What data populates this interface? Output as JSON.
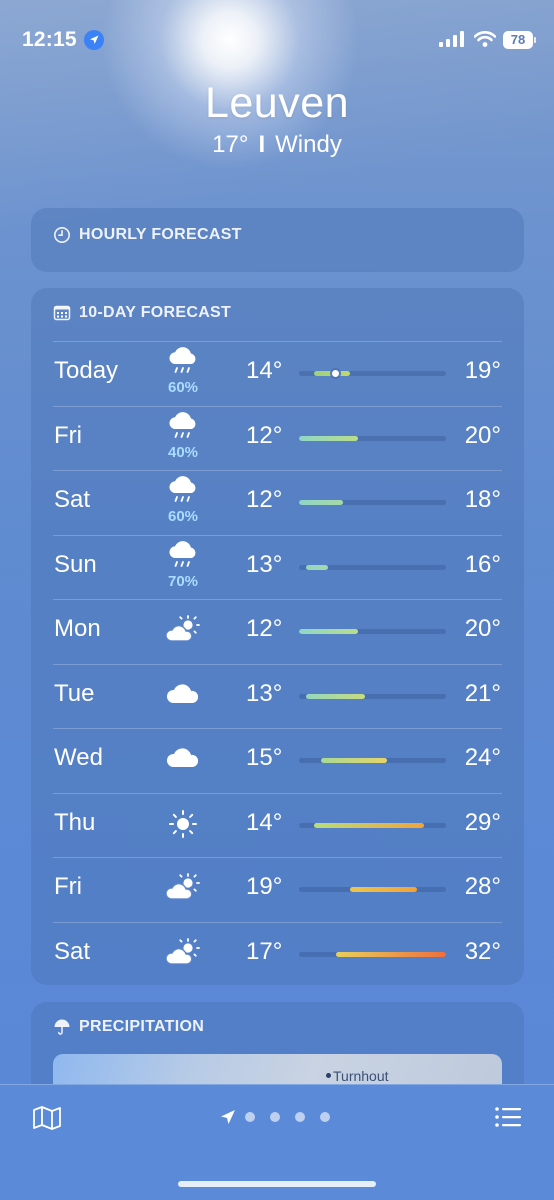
{
  "status_bar": {
    "time": "12:15",
    "battery": "78",
    "location_icon": "location-arrow-icon",
    "signal_icon": "cellular-signal-icon",
    "wifi_icon": "wifi-icon"
  },
  "header": {
    "city": "Leuven",
    "temperature": "17°",
    "separator": "I",
    "condition": "Windy"
  },
  "hourly": {
    "title": "HOURLY FORECAST",
    "icon": "clock-icon"
  },
  "ten_day": {
    "title": "10-DAY FORECAST",
    "icon": "calendar-icon",
    "rows": [
      {
        "day": "Today",
        "icon": "rain-cloud-icon",
        "precip": "60%",
        "low": "14°",
        "high": "19°",
        "low_value": 14,
        "high_value": 19,
        "current_value": 17,
        "gradient": [
          "#9ed07a",
          "#c3d96a"
        ]
      },
      {
        "day": "Fri",
        "icon": "rain-cloud-icon",
        "precip": "40%",
        "low": "12°",
        "high": "20°",
        "low_value": 12,
        "high_value": 20,
        "gradient": [
          "#8fd6c7",
          "#b9dd8a"
        ]
      },
      {
        "day": "Sat",
        "icon": "rain-cloud-icon",
        "precip": "60%",
        "low": "12°",
        "high": "18°",
        "low_value": 12,
        "high_value": 18,
        "gradient": [
          "#8fd6c7",
          "#a6d8a8"
        ]
      },
      {
        "day": "Sun",
        "icon": "rain-cloud-icon",
        "precip": "70%",
        "low": "13°",
        "high": "16°",
        "low_value": 13,
        "high_value": 16,
        "gradient": [
          "#95d6bf",
          "#a3d8ac"
        ]
      },
      {
        "day": "Mon",
        "icon": "partly-sunny-icon",
        "precip": "",
        "low": "12°",
        "high": "20°",
        "low_value": 12,
        "high_value": 20,
        "gradient": [
          "#8fd6c7",
          "#b9dd8a"
        ]
      },
      {
        "day": "Tue",
        "icon": "cloud-icon",
        "precip": "",
        "low": "13°",
        "high": "21°",
        "low_value": 13,
        "high_value": 21,
        "gradient": [
          "#95d6bf",
          "#c7dc7e"
        ]
      },
      {
        "day": "Wed",
        "icon": "cloud-icon",
        "precip": "",
        "low": "15°",
        "high": "24°",
        "low_value": 15,
        "high_value": 24,
        "gradient": [
          "#a8d994",
          "#e6d46a"
        ]
      },
      {
        "day": "Thu",
        "icon": "sun-icon",
        "precip": "",
        "low": "14°",
        "high": "29°",
        "low_value": 14,
        "high_value": 29,
        "gradient": [
          "#b8dd7c",
          "#f2a33a"
        ]
      },
      {
        "day": "Fri",
        "icon": "partly-sunny-icon",
        "precip": "",
        "low": "19°",
        "high": "28°",
        "low_value": 19,
        "high_value": 28,
        "gradient": [
          "#ecc64e",
          "#f3a237"
        ]
      },
      {
        "day": "Sat",
        "icon": "partly-sunny-icon",
        "precip": "",
        "low": "17°",
        "high": "32°",
        "low_value": 17,
        "high_value": 32,
        "gradient": [
          "#e8d05a",
          "#ef6f3d"
        ]
      }
    ]
  },
  "precipitation": {
    "title": "PRECIPITATION",
    "icon": "umbrella-icon",
    "map_label": "Turnhout"
  },
  "bottom_bar": {
    "map_icon": "map-icon",
    "list_icon": "list-icon",
    "pages": 4
  },
  "range": {
    "min": 12,
    "max": 32
  }
}
